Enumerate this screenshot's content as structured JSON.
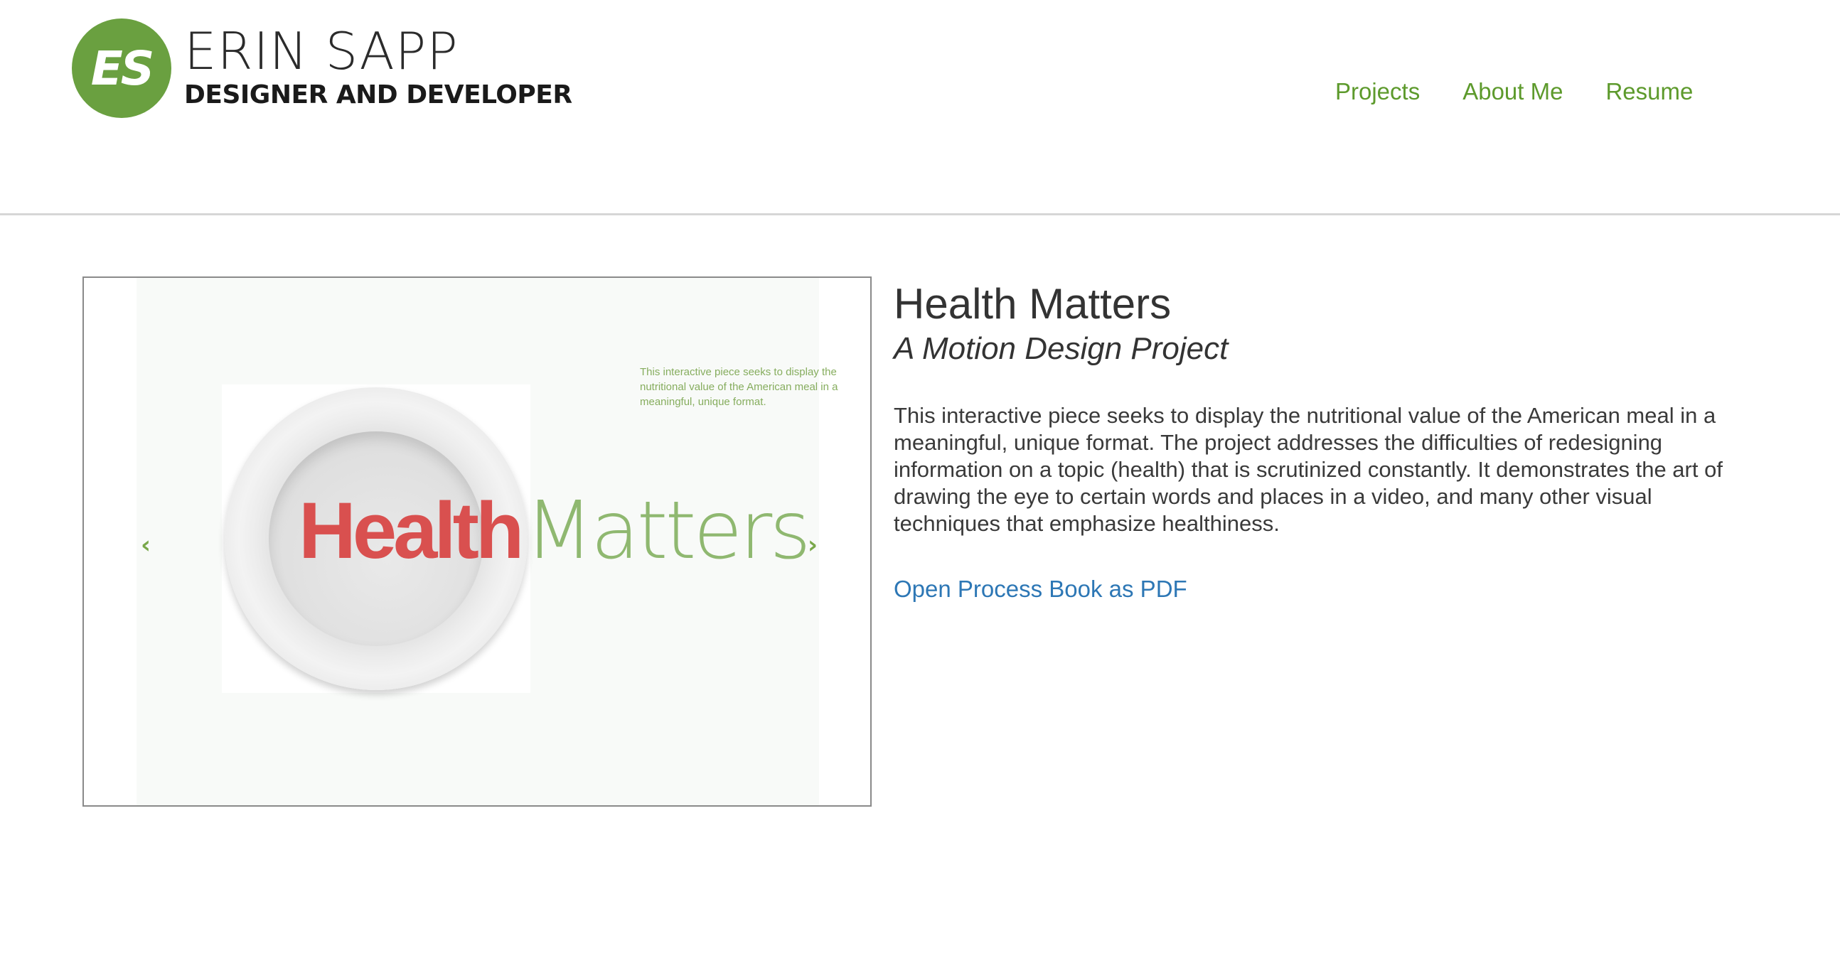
{
  "header": {
    "logo_initials": "ES",
    "logo_name": "ERIN SAPP",
    "logo_tagline": "DESIGNER AND DEVELOPER",
    "nav": [
      {
        "label": "Projects"
      },
      {
        "label": "About Me"
      },
      {
        "label": "Resume"
      }
    ]
  },
  "slideshow": {
    "caption": "This interactive piece seeks to display the nutritional value of the American meal in a meaningful, unique format.",
    "title_part1": "Health",
    "title_part2": "Matters",
    "prev_icon": "‹",
    "next_icon": "›"
  },
  "project": {
    "title": "Health Matters",
    "subtitle": "A Motion Design Project",
    "description": "This interactive piece seeks to display the nutritional value of the American meal in a meaningful, unique format. The project addresses the difficulties of redesigning information on a topic (health) that is scrutinized constantly. It demonstrates the art of drawing the eye to certain words and places in a video, and many other visual techniques that emphasize healthiness.",
    "pdf_link": "Open Process Book as PDF"
  },
  "colors": {
    "brand_green": "#6aa040",
    "nav_green": "#5d9a2c",
    "link_blue": "#2d77b5",
    "slide_red": "#d9504f"
  }
}
